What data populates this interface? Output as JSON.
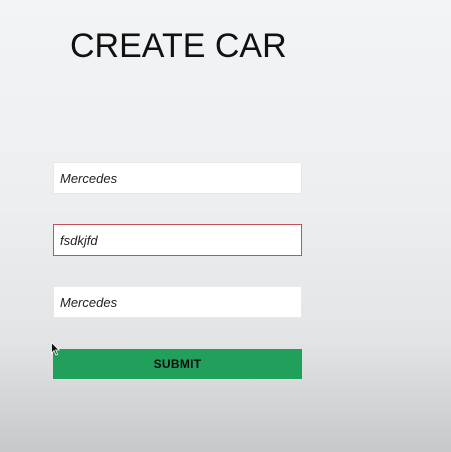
{
  "page": {
    "title": "CREATE CAR"
  },
  "form": {
    "fields": [
      {
        "value": "Mercedes",
        "placeholder": ""
      },
      {
        "value": "fsdkjfd",
        "placeholder": ""
      },
      {
        "value": "Mercedes",
        "placeholder": ""
      }
    ],
    "submit_label": "SUBMIT"
  },
  "colors": {
    "submit_bg": "#21a05c",
    "invalid_border": "#c8505a",
    "background": "#eceef0"
  },
  "icons": {
    "cursor": "mouse-pointer-icon"
  }
}
